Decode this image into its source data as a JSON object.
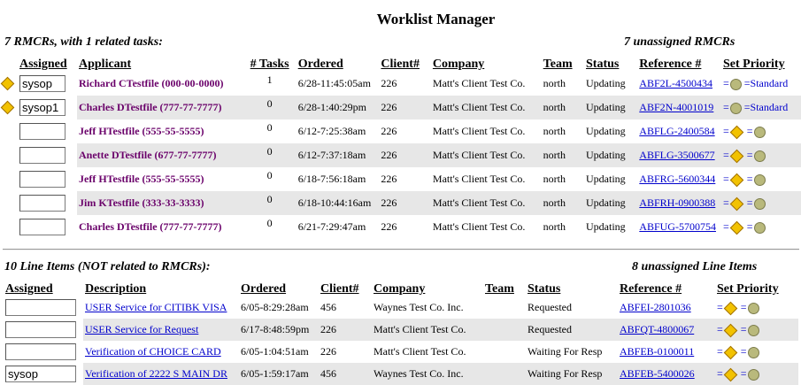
{
  "title": "Worklist Manager",
  "rmcr": {
    "summary": "7 RMCRs, with 1 related tasks:",
    "unassigned": "7 unassigned RMCRs",
    "headers": [
      "Assigned",
      "Applicant",
      "# Tasks",
      "Ordered",
      "Client#",
      "Company",
      "Team",
      "Status",
      "Reference #",
      "Set Priority"
    ],
    "rows": [
      {
        "assigned": "sysop",
        "applicant": "Richard CTestfile  (000-00-0000)",
        "tasks": "1",
        "ordered": "6/28-11:45:05am",
        "client": "226",
        "company": "Matt's Client Test Co.",
        "team": "north",
        "status": "Updating",
        "reference": "ABF2L-4500434",
        "priority": "standard",
        "flag": true
      },
      {
        "assigned": "sysop1",
        "applicant": "Charles DTestfile  (777-77-7777)",
        "tasks": "0",
        "ordered": "6/28-1:40:29pm",
        "client": "226",
        "company": "Matt's Client Test Co.",
        "team": "north",
        "status": "Updating",
        "reference": "ABF2N-4001019",
        "priority": "standard",
        "flag": true
      },
      {
        "assigned": "",
        "applicant": "Jeff HTestfile  (555-55-5555)",
        "tasks": "0",
        "ordered": "6/12-7:25:38am",
        "client": "226",
        "company": "Matt's Client Test Co.",
        "team": "north",
        "status": "Updating",
        "reference": "ABFLG-2400584",
        "priority": "options",
        "flag": false
      },
      {
        "assigned": "",
        "applicant": "Anette DTestfile  (677-77-7777)",
        "tasks": "0",
        "ordered": "6/12-7:37:18am",
        "client": "226",
        "company": "Matt's Client Test Co.",
        "team": "north",
        "status": "Updating",
        "reference": "ABFLG-3500677",
        "priority": "options",
        "flag": false
      },
      {
        "assigned": "",
        "applicant": "Jeff HTestfile  (555-55-5555)",
        "tasks": "0",
        "ordered": "6/18-7:56:18am",
        "client": "226",
        "company": "Matt's Client Test Co.",
        "team": "north",
        "status": "Updating",
        "reference": "ABFRG-5600344",
        "priority": "options",
        "flag": false
      },
      {
        "assigned": "",
        "applicant": "Jim KTestfile  (333-33-3333)",
        "tasks": "0",
        "ordered": "6/18-10:44:16am",
        "client": "226",
        "company": "Matt's Client Test Co.",
        "team": "north",
        "status": "Updating",
        "reference": "ABFRH-0900388",
        "priority": "options",
        "flag": false
      },
      {
        "assigned": "",
        "applicant": "Charles DTestfile  (777-77-7777)",
        "tasks": "0",
        "ordered": "6/21-7:29:47am",
        "client": "226",
        "company": "Matt's Client Test Co.",
        "team": "north",
        "status": "Updating",
        "reference": "ABFUG-5700754",
        "priority": "options",
        "flag": false
      }
    ],
    "priority_text": {
      "equals": "=",
      "standard": "=Standard"
    }
  },
  "lines": {
    "summary": "10 Line Items (NOT related to RMCRs):",
    "unassigned": "8 unassigned Line Items",
    "headers": [
      "Assigned",
      "Description",
      "Ordered",
      "Client#",
      "Company",
      "Team",
      "Status",
      "Reference #",
      "Set Priority"
    ],
    "rows": [
      {
        "assigned": "",
        "description": "USER Service for CITIBK VISA",
        "ordered": "6/05-8:29:28am",
        "client": "456",
        "company": "Waynes Test Co. Inc.",
        "team": "",
        "status": "Requested",
        "reference": "ABFEI-2801036"
      },
      {
        "assigned": "",
        "description": "USER Service for Request",
        "ordered": "6/17-8:48:59pm",
        "client": "226",
        "company": "Matt's Client Test Co.",
        "team": "",
        "status": "Requested",
        "reference": "ABFQT-4800067"
      },
      {
        "assigned": "",
        "description": "Verification of CHOICE CARD",
        "ordered": "6/05-1:04:51am",
        "client": "226",
        "company": "Matt's Client Test Co.",
        "team": "",
        "status": "Waiting For Resp",
        "reference": "ABFEB-0100011"
      },
      {
        "assigned": "sysop",
        "description": "Verification of 2222 S MAIN DR",
        "ordered": "6/05-1:59:17am",
        "client": "456",
        "company": "Waynes Test Co. Inc.",
        "team": "",
        "status": "Waiting For Resp",
        "reference": "ABFEB-5400026"
      }
    ]
  },
  "colors": {
    "applicant": "#6a006a",
    "link": "#0000cc",
    "row_shade": "#e7e7e7",
    "flag": "#f2c200",
    "dot": "#b9b97c"
  },
  "icons": {
    "flag": "yellow-diamond-icon",
    "priority_high": "yellow-diamond-icon",
    "priority_normal": "olive-dot-icon"
  }
}
